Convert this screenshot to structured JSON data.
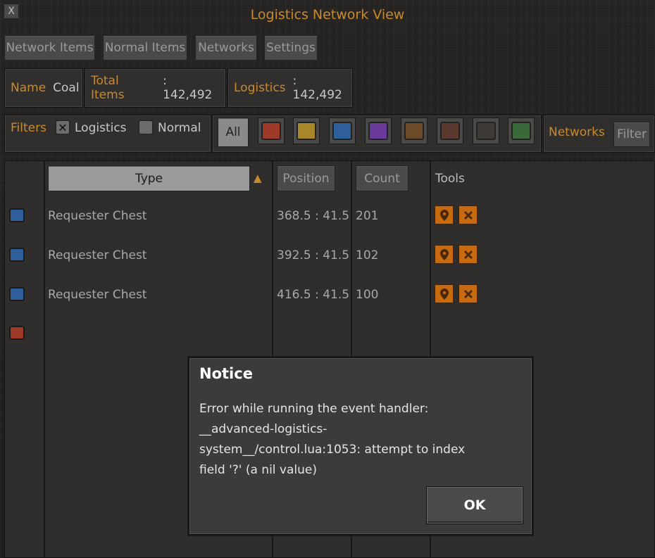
{
  "window": {
    "title": "Logistics Network View",
    "close_label": "X"
  },
  "tabs": [
    "Network Items",
    "Normal Items",
    "Networks",
    "Settings"
  ],
  "info": {
    "name_label": "Name",
    "name_value": "Coal",
    "total_label": "Total Items",
    "total_value": ": 142,492",
    "logistics_label": "Logistics",
    "logistics_value": ": 142,492"
  },
  "filters": {
    "label": "Filters",
    "logistics_label": "Logistics",
    "logistics_checked": true,
    "normal_label": "Normal",
    "normal_checked": false,
    "all_label": "All",
    "chest_icons": [
      "active-provider-chest-icon",
      "passive-provider-chest-icon",
      "storage-chest-icon",
      "requester-chest-icon",
      "wooden-chest-icon",
      "iron-chest-icon",
      "steel-chest-icon",
      "logistic-robot-chest-icon"
    ],
    "networks_label": "Networks",
    "filter_button": "Filter"
  },
  "table": {
    "headers": {
      "type": "Type",
      "position": "Position",
      "count": "Count",
      "tools": "Tools"
    },
    "rows": [
      {
        "type": "Requester Chest",
        "position": "368.5 : 41.5",
        "count": "201"
      },
      {
        "type": "Requester Chest",
        "position": "392.5 : 41.5",
        "count": "102"
      },
      {
        "type": "Requester Chest",
        "position": "416.5 : 41.5",
        "count": "100"
      }
    ]
  },
  "dialog": {
    "title": "Notice",
    "message_line1": "Error while running the event handler:",
    "message_line2": "__advanced-logistics-",
    "message_line3": "system__/control.lua:1053: attempt to index",
    "message_line4": "field '?' (a nil value)",
    "ok_label": "OK"
  },
  "colors": {
    "accent": "#c98a2e",
    "tool": "#c76a10"
  }
}
